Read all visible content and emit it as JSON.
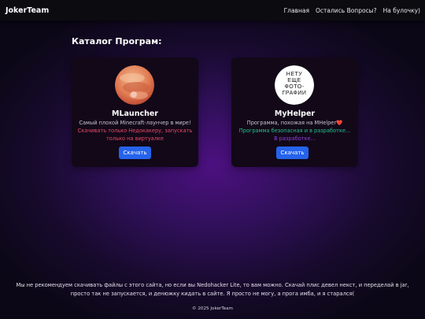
{
  "navbar": {
    "brand": "JokerTeam",
    "links": [
      "Главная",
      "Остались Вопросы?",
      "На булочку)"
    ]
  },
  "catalog": {
    "title": "Каталог Програм:"
  },
  "cards": [
    {
      "title": "MLauncher",
      "description": "Самый плохой Minecraft-лаунчер в мире!",
      "warning": "Скачивать только Недокакеру, запускать только на виртуалке",
      "button": "Скачать"
    },
    {
      "title": "MyHelper",
      "description": "Программа, похожая на MHelper❤️",
      "safety_note": "Программа безопасная и в разработке...",
      "dev_note": "В разработке...",
      "logo_text": "НЕТУ ЕЩЕ ФОТО- ГРАФИИ",
      "button": "Скачать"
    }
  ],
  "disclaimer": "Мы не рекомендуем скачивать файлы с этого сайта, но если вы Nedohacker Lite, то вам можно. Скачай плис девел некст, и переделай в jar, просто так не запускается, и денюжку кидать в сайте. Я просто не могу, а прога имба, и я старался(",
  "footer": "© 2025 JokerTeam",
  "colors": {
    "accent_button": "#2563eb",
    "warning_red": "#ea4a66",
    "safe_green": "#25c08a",
    "dev_purple": "#8f3fd9"
  }
}
